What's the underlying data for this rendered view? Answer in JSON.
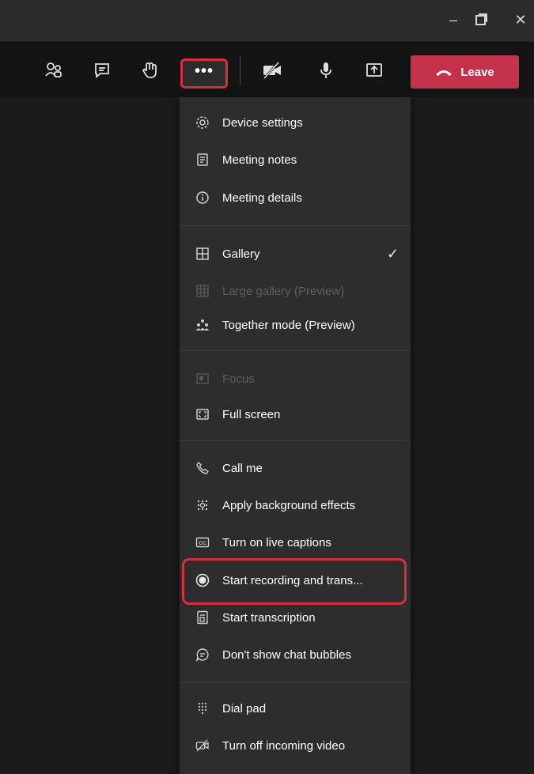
{
  "window": {
    "controls": [
      {
        "name": "minimize-icon",
        "glyph": "–"
      },
      {
        "name": "maximize-icon",
        "glyph": "❐"
      },
      {
        "name": "close-icon",
        "glyph": "✕"
      }
    ]
  },
  "toolbar": {
    "more_glyph": "•••",
    "leave_label": "Leave",
    "leave_color": "#c4314b",
    "highlight_color": "#d6303e"
  },
  "menu": {
    "items": [
      {
        "label": "Device settings",
        "icon": "gear-icon",
        "enabled": true
      },
      {
        "label": "Meeting notes",
        "icon": "notes-icon",
        "enabled": true
      },
      {
        "label": "Meeting details",
        "icon": "info-icon",
        "enabled": true
      },
      {
        "label": "Gallery",
        "icon": "gallery-icon",
        "enabled": true,
        "checked": true
      },
      {
        "label": "Large gallery (Preview)",
        "icon": "large-gallery-icon",
        "enabled": false
      },
      {
        "label": "Together mode (Preview)",
        "icon": "together-mode-icon",
        "enabled": true
      },
      {
        "label": "Focus",
        "icon": "focus-icon",
        "enabled": false
      },
      {
        "label": "Full screen",
        "icon": "fullscreen-icon",
        "enabled": true
      },
      {
        "label": "Call me",
        "icon": "phone-icon",
        "enabled": true
      },
      {
        "label": "Apply background effects",
        "icon": "background-effects-icon",
        "enabled": true
      },
      {
        "label": "Turn on live captions",
        "icon": "captions-icon",
        "enabled": true
      },
      {
        "label": "Start recording and trans...",
        "icon": "record-icon",
        "enabled": true,
        "highlighted": true
      },
      {
        "label": "Start transcription",
        "icon": "transcription-icon",
        "enabled": true
      },
      {
        "label": "Don't show chat bubbles",
        "icon": "chat-bubble-icon",
        "enabled": true
      },
      {
        "label": "Dial pad",
        "icon": "dialpad-icon",
        "enabled": true
      },
      {
        "label": "Turn off incoming video",
        "icon": "video-off-icon",
        "enabled": true
      }
    ],
    "checkmark": "✓"
  }
}
